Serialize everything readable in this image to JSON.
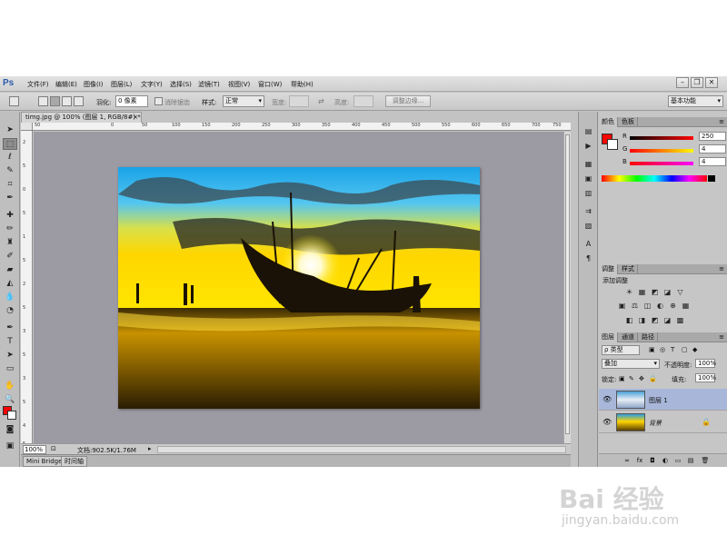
{
  "app": {
    "logo": "Ps"
  },
  "menu": [
    "文件(F)",
    "编辑(E)",
    "图像(I)",
    "图层(L)",
    "文字(Y)",
    "选择(S)",
    "滤镜(T)",
    "视图(V)",
    "窗口(W)",
    "帮助(H)"
  ],
  "window_buttons": [
    "–",
    "❐",
    "✕"
  ],
  "options": {
    "feather_label": "羽化:",
    "feather_value": "0 像素",
    "antialias_label": "消除锯齿",
    "style_label": "样式:",
    "style_value": "正常",
    "width_label": "宽度:",
    "height_label": "高度:",
    "refine_edge": "调整边缘...",
    "workspace": "基本功能"
  },
  "document": {
    "tab_title": "timg.jpg @ 100% (图层 1, RGB/8#) *",
    "close": "×",
    "zoom": "100%",
    "doc_info": "文档:902.5K/1.76M",
    "ruler_h_labels": [
      "50",
      "0",
      "50",
      "100",
      "150",
      "200",
      "250",
      "300",
      "350",
      "400",
      "450",
      "500",
      "550",
      "600",
      "650",
      "700",
      "750",
      "800"
    ],
    "ruler_v_labels": [
      "2",
      "5",
      "0",
      "5",
      "1",
      "5",
      "2",
      "5",
      "3",
      "5",
      "3",
      "5",
      "4",
      "5"
    ]
  },
  "bottom_tabs": [
    "Mini Bridge",
    "时间轴"
  ],
  "color_panel": {
    "tabs": [
      "颜色",
      "色板"
    ],
    "channels": [
      {
        "label": "R",
        "value": "250"
      },
      {
        "label": "G",
        "value": "4"
      },
      {
        "label": "B",
        "value": "4"
      }
    ],
    "foreground": "#fa0404"
  },
  "adjustments_panel": {
    "tabs": [
      "调整",
      "样式"
    ],
    "title": "添加调整",
    "row1": [
      "☀",
      "▦",
      "◩",
      "◪",
      "▽"
    ],
    "row2": [
      "▣",
      "⚖",
      "◫",
      "◐",
      "⊕",
      "▦"
    ],
    "row3": [
      "◧",
      "◨",
      "◩",
      "◪",
      "▩"
    ]
  },
  "layers_panel": {
    "tabs": [
      "图层",
      "通道",
      "路径"
    ],
    "filter_kind": "ρ 类型",
    "filter_icons": [
      "▣",
      "◎",
      "T",
      "▢",
      "◆"
    ],
    "blend_mode": "叠加",
    "opacity_label": "不透明度:",
    "opacity_value": "100%",
    "lock_label": "锁定:",
    "lock_icons": [
      "▣",
      "✎",
      "✥",
      "🔒"
    ],
    "fill_label": "填充:",
    "fill_value": "100%",
    "layers": [
      {
        "name": "图层 1",
        "selected": true,
        "locked": false
      },
      {
        "name": "背景",
        "selected": false,
        "locked": true
      }
    ],
    "bottom_icons": [
      "∞",
      "fx",
      "◘",
      "◐",
      "▭",
      "▤",
      "🗑"
    ]
  },
  "watermark": {
    "brand": "Bai 经验",
    "url": "jingyan.baidu.com"
  },
  "colors": {
    "selected_layer": "#a8b7d9",
    "canvas_bg": "#9c9aa3",
    "panel_bg": "#c6c6c6"
  }
}
